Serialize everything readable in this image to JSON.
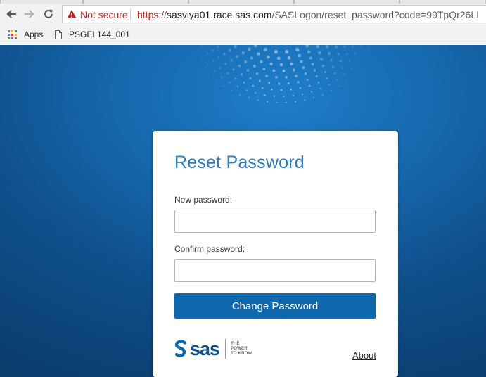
{
  "browser": {
    "security_label": "Not secure",
    "url": {
      "scheme": "https",
      "separator": "://",
      "host": "sasviya01.race.sas.com",
      "path": "/SASLogon/reset_password?code=99TpQr26LI"
    },
    "icons": {
      "back": "arrow-left-icon",
      "forward": "arrow-right-icon",
      "reload": "reload-icon",
      "security": "warning-triangle-icon"
    },
    "bookmarks": [
      {
        "label": "Apps",
        "icon": "apps-grid-icon"
      },
      {
        "label": "PSGEL144_001",
        "icon": "page-icon"
      }
    ]
  },
  "reset_form": {
    "title": "Reset Password",
    "new_password_label": "New password:",
    "new_password_value": "",
    "confirm_password_label": "Confirm password:",
    "confirm_password_value": "",
    "submit_label": "Change Password"
  },
  "footer": {
    "logo_text": "sas",
    "tagline": [
      "THE",
      "POWER",
      "TO KNOW."
    ],
    "about_link": "About"
  },
  "colors": {
    "accent": "#2e7bbd",
    "button": "#0f68ad",
    "background_dark": "#0a3c6c",
    "background_light": "#1f7ec9",
    "insecure_red": "#c5221f",
    "logo_blue": "#0f4f8b"
  }
}
